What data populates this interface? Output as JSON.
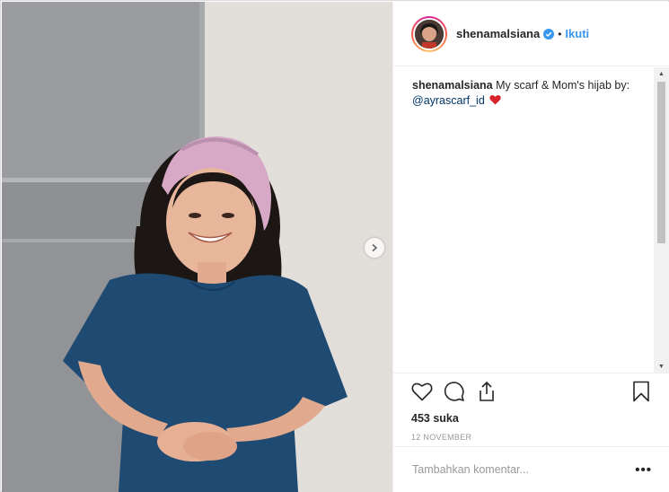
{
  "post": {
    "photo_description_icon": "photo-of-woman-with-pink-headscarf",
    "next_icon": "chevron-right-icon"
  },
  "header": {
    "username": "shenamalsiana",
    "verified_icon": "verified-badge-icon",
    "separator": "•",
    "follow_label": "Ikuti"
  },
  "caption": {
    "username": "shenamalsiana",
    "text": "My scarf & Mom's hijab by:",
    "mention": "@ayrascarf_id",
    "emoji": "heart-icon"
  },
  "actions": {
    "like_icon": "heart-outline-icon",
    "comment_icon": "comment-icon",
    "share_icon": "share-icon",
    "save_icon": "bookmark-icon",
    "likes": "453 suka",
    "date": "12 NOVEMBER"
  },
  "comment_box": {
    "placeholder": "Tambahkan komentar...",
    "more_label": "•••"
  },
  "colors": {
    "link": "#3897f0",
    "mention": "#003569",
    "heart": "#ed4956",
    "border": "#efefef"
  }
}
